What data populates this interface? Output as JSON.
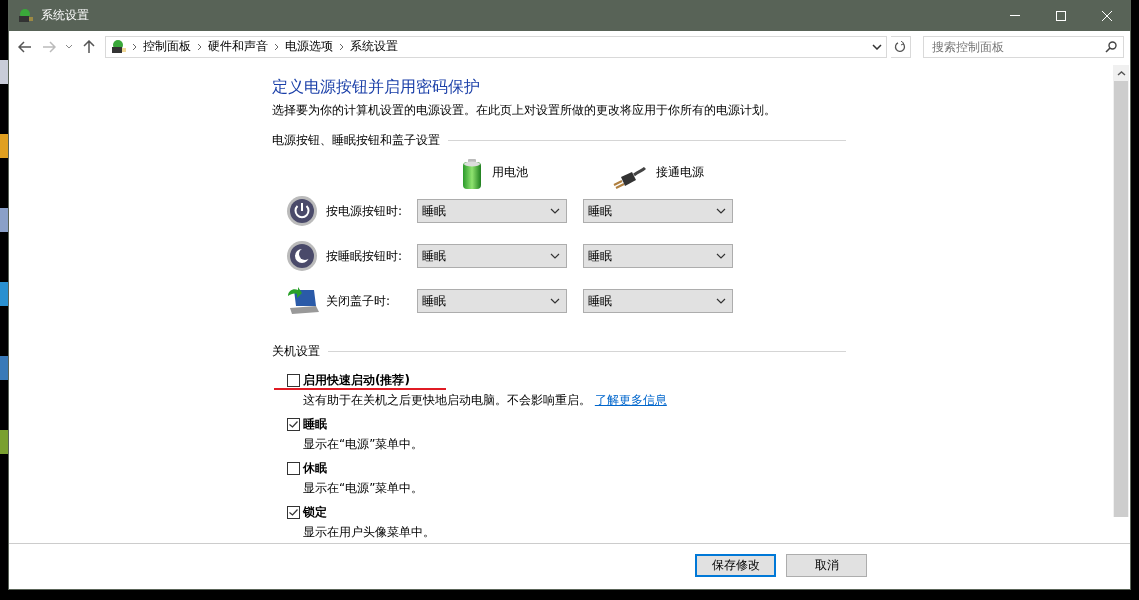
{
  "window": {
    "title": "系统设置"
  },
  "nav": {
    "breadcrumb": [
      "控制面板",
      "硬件和声音",
      "电源选项",
      "系统设置"
    ],
    "search": {
      "placeholder": "搜索控制面板"
    }
  },
  "page": {
    "heading": "定义电源按钮并启用密码保护",
    "description": "选择要为你的计算机设置的电源设置。在此页上对设置所做的更改将应用于你所有的电源计划。"
  },
  "buttons_section": {
    "title": "电源按钮、睡眠按钮和盖子设置",
    "columns": [
      {
        "kind": "battery",
        "label": "用电池"
      },
      {
        "kind": "plugged",
        "label": "接通电源"
      }
    ],
    "rows": [
      {
        "kind": "power",
        "label": "按电源按钮时:",
        "values": [
          "睡眠",
          "睡眠"
        ]
      },
      {
        "kind": "sleep",
        "label": "按睡眠按钮时:",
        "values": [
          "睡眠",
          "睡眠"
        ]
      },
      {
        "kind": "lid",
        "label": "关闭盖子时:",
        "values": [
          "睡眠",
          "睡眠"
        ]
      }
    ]
  },
  "shutdown": {
    "title": "关机设置",
    "options": [
      {
        "label": "启用快速启动(推荐)",
        "checked": false,
        "underlined": true,
        "description": "这有助于在关机之后更快地启动电脑。不会影响重启。",
        "link": "了解更多信息"
      },
      {
        "label": "睡眠",
        "checked": true,
        "underlined": false,
        "description": "显示在“电源”菜单中。"
      },
      {
        "label": "休眠",
        "checked": false,
        "underlined": false,
        "description": "显示在“电源”菜单中。"
      },
      {
        "label": "锁定",
        "checked": true,
        "underlined": false,
        "description": "显示在用户头像菜单中。"
      }
    ]
  },
  "footer": {
    "buttons": [
      {
        "label": "保存修改",
        "default": true
      },
      {
        "label": "取消",
        "default": false
      }
    ]
  }
}
